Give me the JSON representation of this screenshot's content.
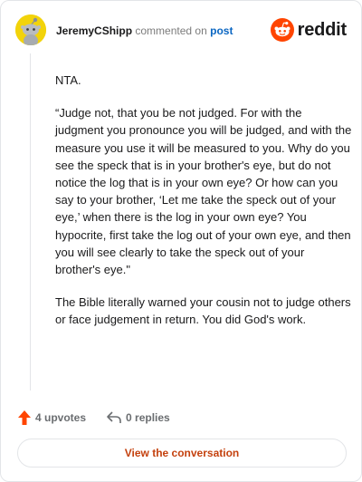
{
  "comment": {
    "username": "JeremyCShipp",
    "action_text": "commented on",
    "post_link": "post",
    "avatar_icon": "snoo-avatar-icon",
    "avatar_color": "#f2d30a"
  },
  "brand": {
    "name": "reddit",
    "icon": "reddit-logo-icon",
    "color": "#ff4500"
  },
  "body": {
    "paragraphs": [
      "NTA.",
      "“Judge not, that you be not judged. For with the judgment you pronounce you will be judged, and with the measure you use it will be measured to you. Why do you see the speck that is in your brother's eye, but do not notice the log that is in your own eye? Or how can you say to your brother, ‘Let me take the speck out of your eye,’ when there is the log in your own eye? You hypocrite, first take the log out of your own eye, and then you will see clearly to take the speck out of your brother's eye.\"",
      "The Bible literally warned your cousin not to judge others or face judgement in return. You did God's work."
    ]
  },
  "footer": {
    "upvotes": "4 upvotes",
    "upvote_icon": "upvote-arrow-icon",
    "upvote_color": "#ff4500",
    "replies": "0 replies",
    "reply_icon": "reply-arrow-icon"
  },
  "cta": {
    "label": "View the conversation",
    "color": "#c4410e"
  }
}
